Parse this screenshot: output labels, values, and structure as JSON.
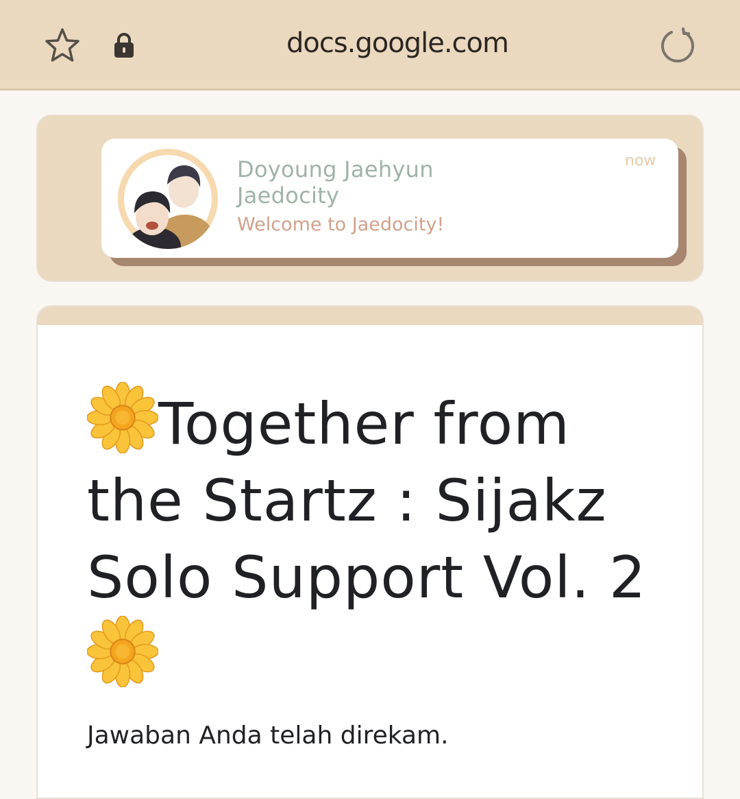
{
  "browser": {
    "url": "docs.google.com",
    "star_icon": "star-outline-icon",
    "lock_icon": "lock-icon",
    "reload_icon": "reload-icon"
  },
  "notification": {
    "title_line1": "Doyoung Jaehyun",
    "title_line2": "Jaedocity",
    "message": "Welcome to Jaedocity!",
    "time": "now"
  },
  "form": {
    "title_part1": "Together from the Startz : Sijakz Solo Support Vol. 2",
    "confirmation": "Jawaban Anda telah direkam.",
    "title_icon": "sunflower-icon"
  },
  "colors": {
    "topbar": "#ead8bf",
    "notification_title": "#9fb3a6",
    "notification_message": "#d2a08a",
    "notification_time": "#e7c9a8",
    "card_shadow": "#a6866e"
  }
}
